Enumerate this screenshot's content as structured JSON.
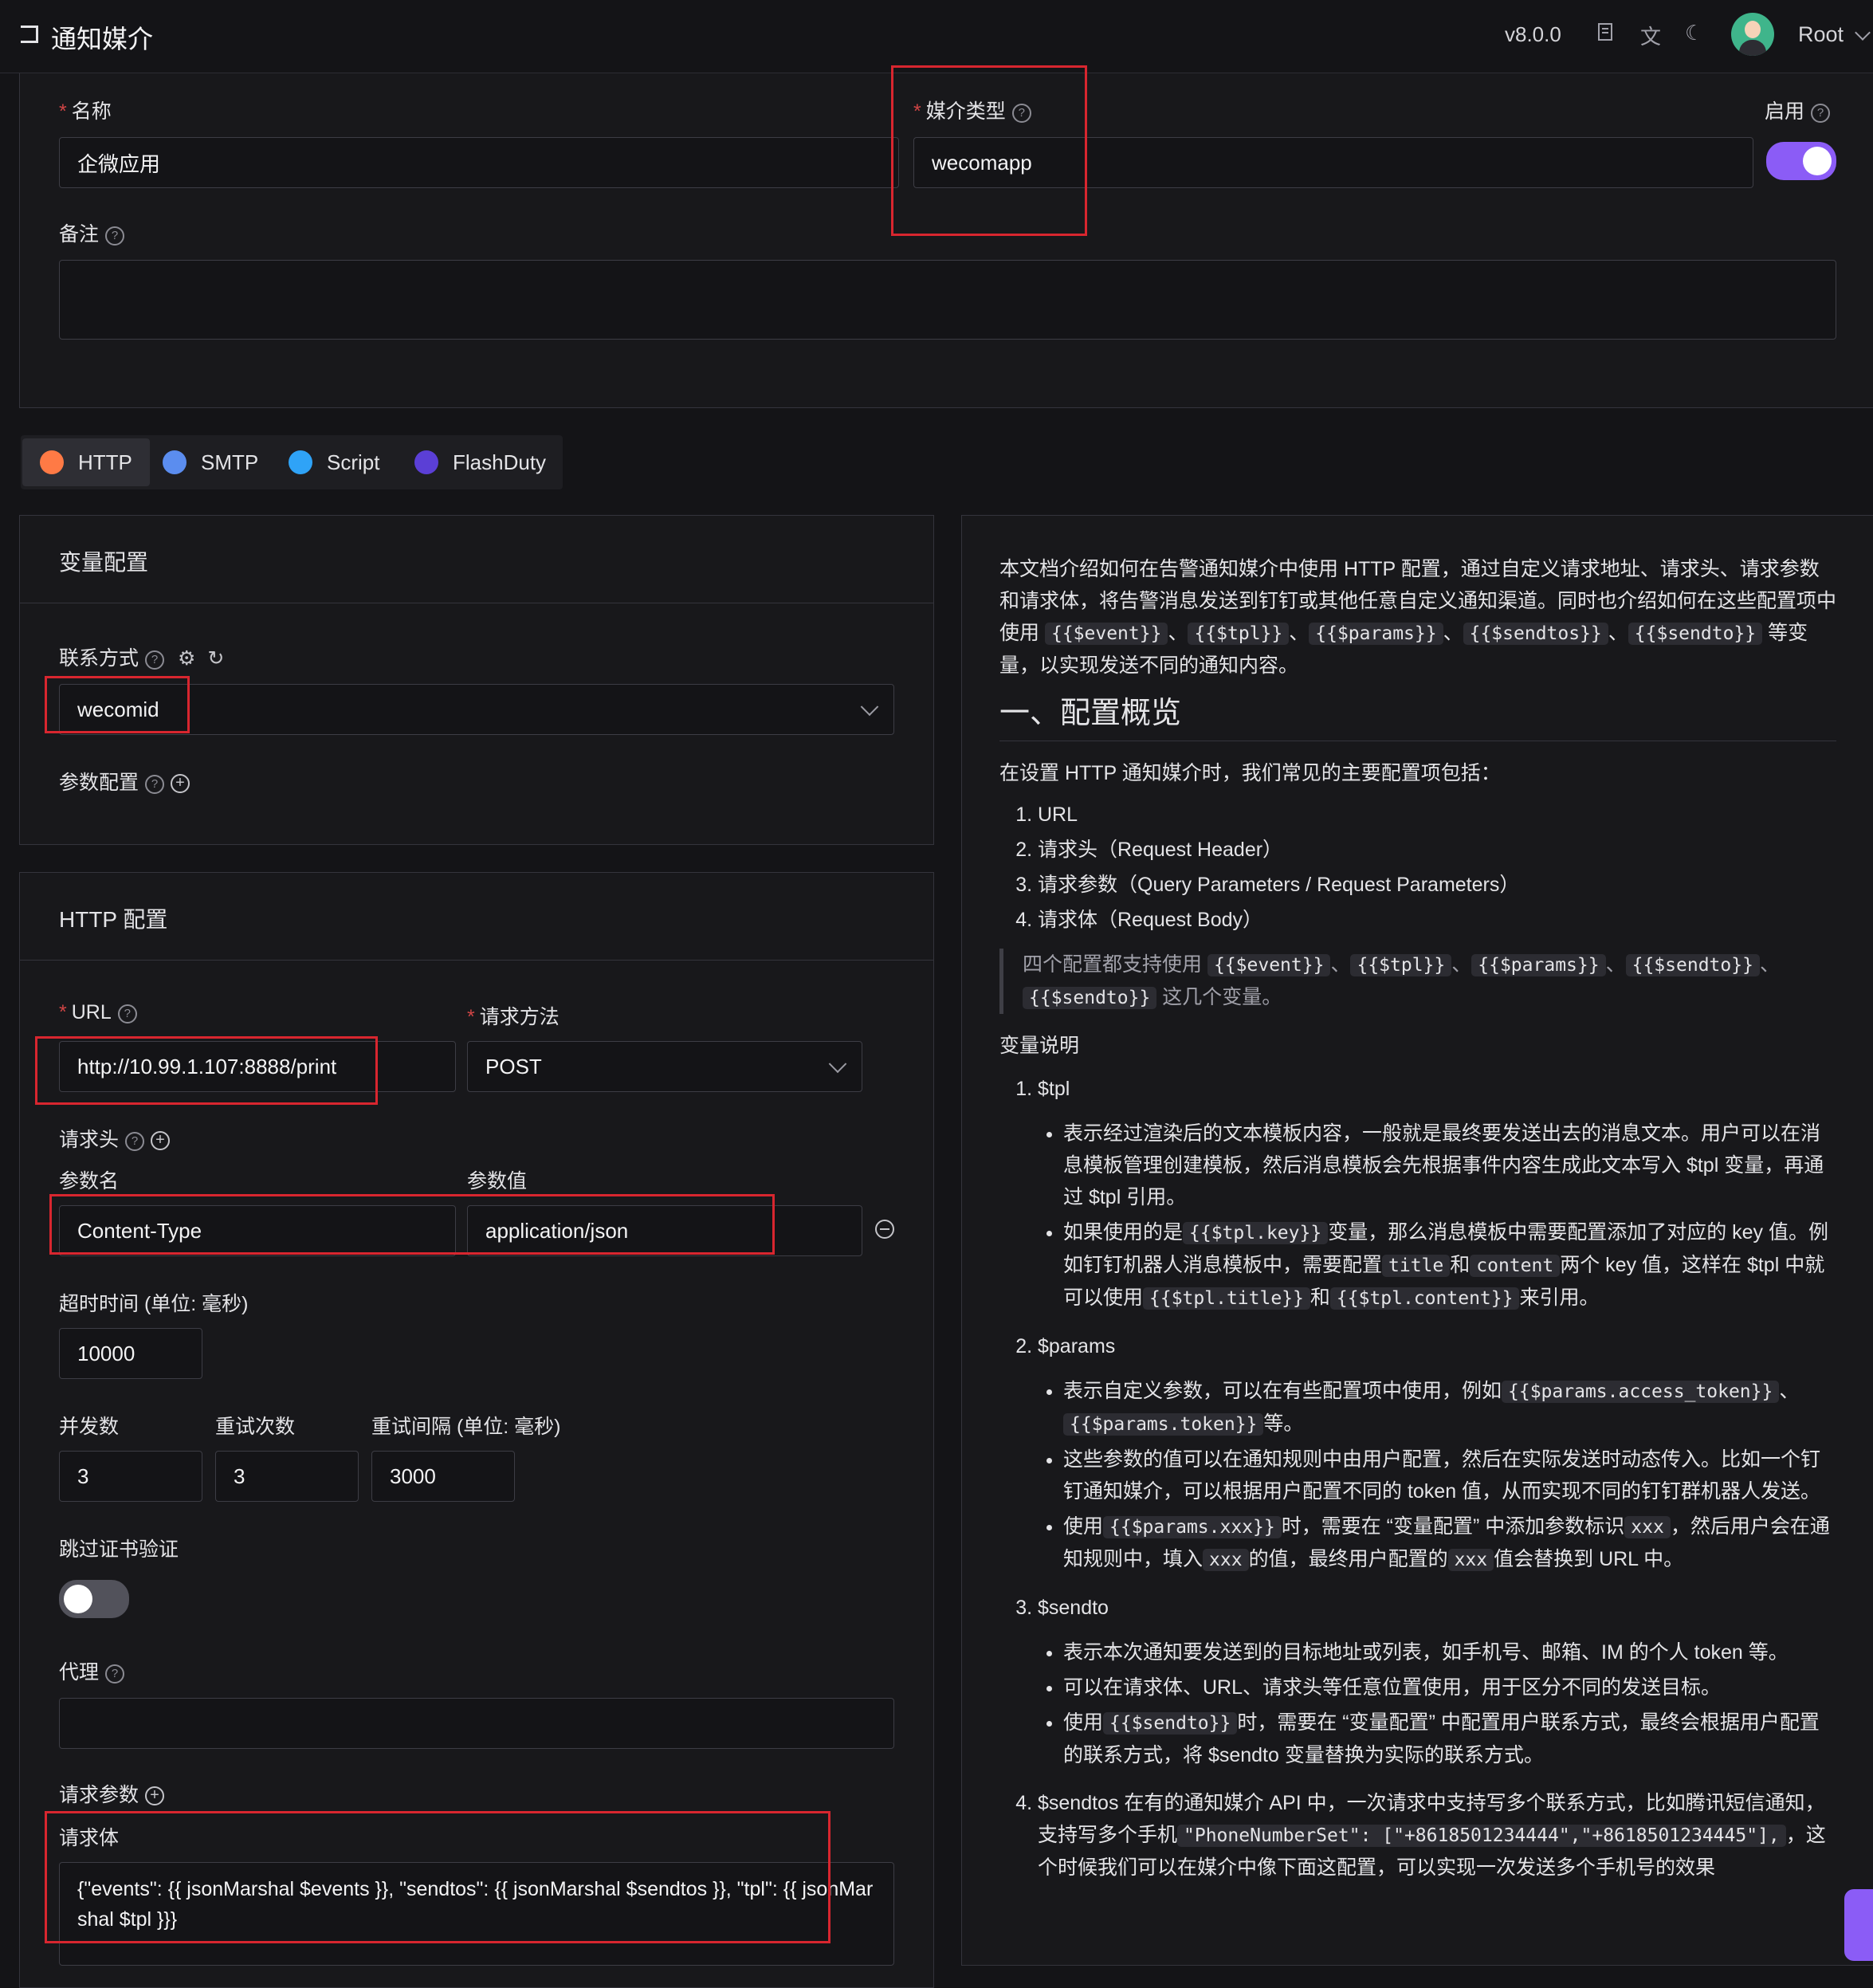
{
  "header": {
    "back_icon": "back-icon",
    "title": "通知媒介",
    "version": "v8.0.0",
    "user": "Root"
  },
  "form": {
    "name_label": "名称",
    "name_value": "企微应用",
    "media_type_label": "媒介类型",
    "media_type_value": "wecomapp",
    "enable_label": "启用",
    "enabled": true,
    "note_label": "备注",
    "note_value": ""
  },
  "tabs": [
    {
      "label": "HTTP",
      "icon": "http-icon",
      "color": "#ff7a45",
      "active": true
    },
    {
      "label": "SMTP",
      "icon": "smtp-icon",
      "color": "#5b8def",
      "active": false
    },
    {
      "label": "Script",
      "icon": "script-icon",
      "color": "#2fa3f7",
      "active": false
    },
    {
      "label": "FlashDuty",
      "icon": "flashduty-icon",
      "color": "#5b3fd6",
      "active": false
    }
  ],
  "var_config": {
    "title": "变量配置",
    "contact_label": "联系方式",
    "contact_value": "wecomid",
    "params_label": "参数配置"
  },
  "http_config": {
    "title": "HTTP 配置",
    "url_label": "URL",
    "url_value": "http://10.99.1.107:8888/print",
    "method_label": "请求方法",
    "method_value": "POST",
    "headers_label": "请求头",
    "param_name_label": "参数名",
    "param_value_label": "参数值",
    "header_name": "Content-Type",
    "header_value": "application/json",
    "timeout_label": "超时时间 (单位: 毫秒)",
    "timeout_value": "10000",
    "concurrency_label": "并发数",
    "concurrency_value": "3",
    "retry_label": "重试次数",
    "retry_value": "3",
    "retry_interval_label": "重试间隔 (单位: 毫秒)",
    "retry_interval_value": "3000",
    "skip_cert_label": "跳过证书验证",
    "skip_cert": false,
    "proxy_label": "代理",
    "proxy_value": "",
    "query_label": "请求参数",
    "body_label": "请求体",
    "body_value": "{\"events\": {{ jsonMarshal $events }}, \"sendtos\": {{ jsonMarshal $sendtos }}, \"tpl\": {{ jsonMarshal $tpl }}}"
  },
  "doc": {
    "intro_1": "本文档介绍如何在告警通知媒介中使用 HTTP 配置，通过自定义请求地址、请求头、请求参数和请求体，将告警消息发送到钉钉或其他任意自定义通知渠道。同时也介绍如何在这些配置项中使用",
    "intro_codes": [
      "{{$event}}",
      "{{$tpl}}",
      "{{$params}}",
      "{{$sendtos}}",
      "{{$sendto}}"
    ],
    "intro_sep": "、",
    "intro_2": "等变量，以实现发送不同的通知内容。",
    "h_overview": "一、配置概览",
    "overview_lead": "在设置 HTTP 通知媒介时，我们常见的主要配置项包括：",
    "overview_items": [
      "URL",
      "请求头（Request Header）",
      "请求参数（Query Parameters / Request Parameters）",
      "请求体（Request Body）"
    ],
    "quote_1": "四个配置都支持使用",
    "quote_codes": [
      "{{$event}}",
      "{{$tpl}}",
      "{{$params}}",
      "{{$sendto}}",
      "{{$sendto}}"
    ],
    "quote_2": "这几个变量。",
    "var_heading": "变量说明",
    "tpl_title": "$tpl",
    "tpl_b1": "表示经过渲染后的文本模板内容，一般就是最终要发送出去的消息文本。用户可以在消息模板管理创建模板，然后消息模板会先根据事件内容生成此文本写入 $tpl 变量，再通过 $tpl 引用。",
    "tpl_b2_a": "如果使用的是",
    "tpl_b2_code1": "{{$tpl.key}}",
    "tpl_b2_b": "变量，那么消息模板中需要配置添加了对应的 key 值。例如钉钉机器人消息模板中，需要配置",
    "tpl_b2_code2": "title",
    "tpl_b2_c": "和",
    "tpl_b2_code3": "content",
    "tpl_b2_d": "两个 key 值，这样在 $tpl 中就可以使用",
    "tpl_b2_code4": "{{$tpl.title}}",
    "tpl_b2_e": "和",
    "tpl_b2_code5": "{{$tpl.content}}",
    "tpl_b2_f": "来引用。",
    "params_title": "$params",
    "params_b1_a": "表示自定义参数，可以在有些配置项中使用，例如",
    "params_b1_code1": "{{$params.access_token}}",
    "params_b1_sep": "、",
    "params_b1_code2": "{{$params.token}}",
    "params_b1_b": "等。",
    "params_b2": "这些参数的值可以在通知规则中由用户配置，然后在实际发送时动态传入。比如一个钉钉通知媒介，可以根据用户配置不同的 token 值，从而实现不同的钉钉群机器人发送。",
    "params_b3_a": "使用",
    "params_b3_code1": "{{$params.xxx}}",
    "params_b3_b": "时，需要在 “变量配置” 中添加参数标识",
    "params_b3_code2": "xxx",
    "params_b3_c": "，然后用户会在通知规则中，填入",
    "params_b3_code3": "xxx",
    "params_b3_d": "的值，最终用户配置的",
    "params_b3_code4": "xxx",
    "params_b3_e": "值会替换到 URL 中。",
    "sendto_title": "$sendto",
    "sendto_b1": "表示本次通知要发送到的目标地址或列表，如手机号、邮箱、IM 的个人 token 等。",
    "sendto_b2": "可以在请求体、URL、请求头等任意位置使用，用于区分不同的发送目标。",
    "sendto_b3_a": "使用",
    "sendto_b3_code": "{{$sendto}}",
    "sendto_b3_b": "时，需要在 “变量配置” 中配置用户联系方式，最终会根据用户配置的联系方式，将 $sendto 变量替换为实际的联系方式。",
    "sendtos_a": "$sendtos 在有的通知媒介 API 中，一次请求中支持写多个联系方式，比如腾讯短信通知，支持写多个手机",
    "sendtos_code": "\"PhoneNumberSet\": [\"+8618501234444\",\"+8618501234445\"],",
    "sendtos_b": "，这个时候我们可以在媒介中像下面这配置，可以实现一次发送多个手机号的效果"
  }
}
